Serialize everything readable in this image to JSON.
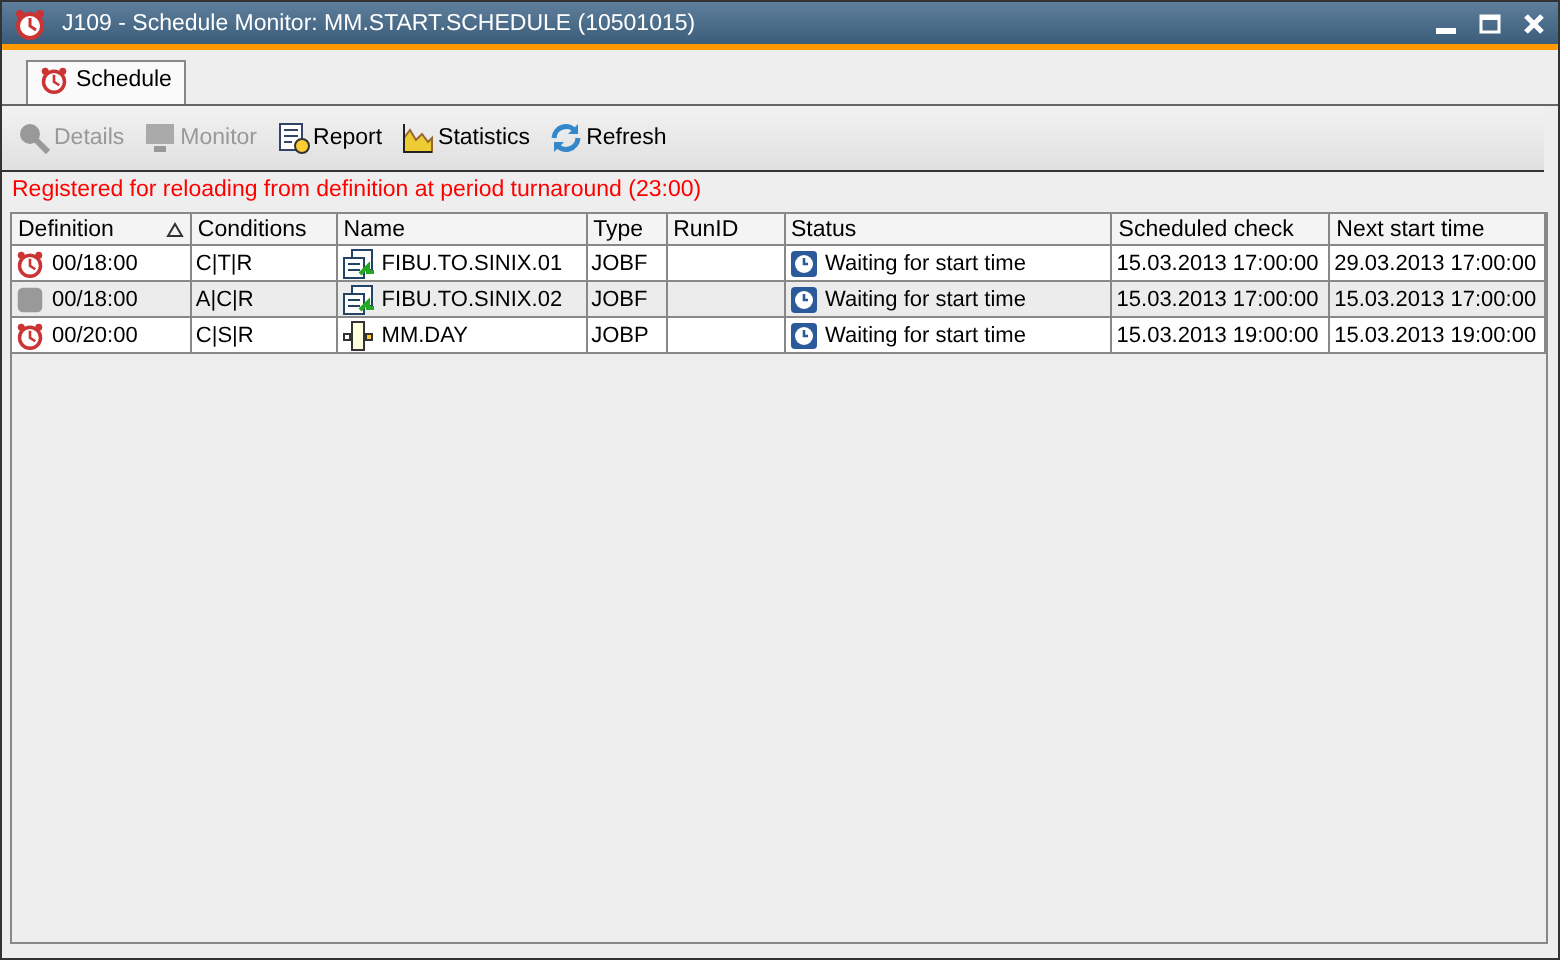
{
  "window": {
    "title": "J109 - Schedule Monitor: MM.START.SCHEDULE (10501015)"
  },
  "tabs": [
    {
      "label": "Schedule",
      "selected": true
    }
  ],
  "toolbar": [
    {
      "kind": "details",
      "label": "Details",
      "disabled": true
    },
    {
      "kind": "monitor",
      "label": "Monitor",
      "disabled": true
    },
    {
      "kind": "report",
      "label": "Report",
      "disabled": false
    },
    {
      "kind": "statistics",
      "label": "Statistics",
      "disabled": false
    },
    {
      "kind": "refresh",
      "label": "Refresh",
      "disabled": false
    }
  ],
  "message": "Registered for reloading from definition at period turnaround (23:00)",
  "table": {
    "columns": [
      "Definition",
      "Conditions",
      "Name",
      "Type",
      "RunID",
      "Status",
      "Scheduled check",
      "Next start time"
    ],
    "rows": [
      {
        "active": true,
        "definition": "00/18:00",
        "conditions": "C|T|R",
        "kind": "jobf",
        "name": "FIBU.TO.SINIX.01",
        "type": "JOBF",
        "status": "Waiting for start time",
        "scheduled_check": "15.03.2013 17:00:00",
        "next_start_time": "29.03.2013 17:00:00"
      },
      {
        "active": false,
        "definition": "00/18:00",
        "conditions": "A|C|R",
        "kind": "jobf",
        "name": "FIBU.TO.SINIX.02",
        "type": "JOBF",
        "status": "Waiting for start time",
        "scheduled_check": "15.03.2013 17:00:00",
        "next_start_time": "15.03.2013 17:00:00"
      },
      {
        "active": true,
        "definition": "00/20:00",
        "conditions": "C|S|R",
        "kind": "jobp",
        "name": "MM.DAY",
        "type": "JOBP",
        "status": "Waiting for start time",
        "scheduled_check": "15.03.2013 19:00:00",
        "next_start_time": "15.03.2013 19:00:00"
      }
    ]
  }
}
